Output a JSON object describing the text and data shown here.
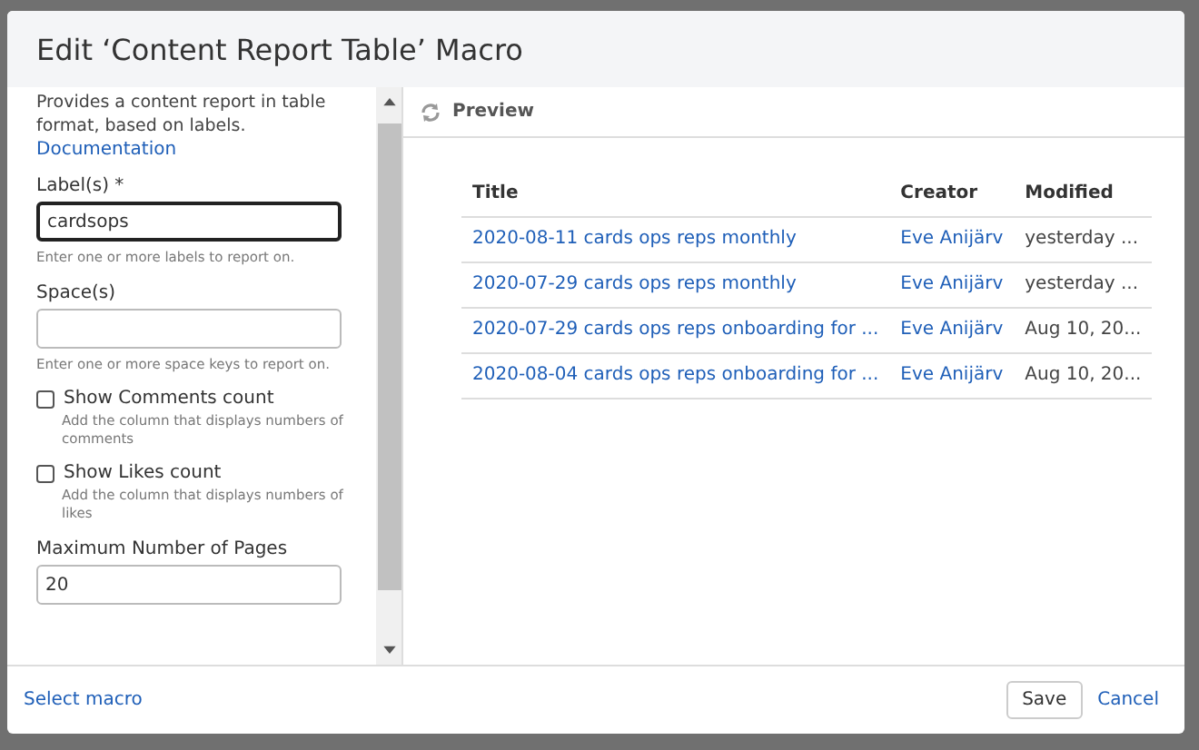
{
  "dialog": {
    "title": "Edit ‘Content Report Table’ Macro"
  },
  "form": {
    "description": "Provides a content report in table format, based on labels.",
    "documentation_link": "Documentation",
    "fields": [
      {
        "kind": "text",
        "label": "Label(s) *",
        "value": "cardsops",
        "focused": true,
        "help": "Enter one or more labels to report on."
      },
      {
        "kind": "text",
        "label": "Space(s)",
        "focused": false,
        "help": "Enter one or more space keys to report on."
      },
      {
        "kind": "checkbox",
        "label": "Show Comments count",
        "checked": false,
        "help": "Add the column that displays numbers of comments"
      },
      {
        "kind": "checkbox",
        "label": "Show Likes count",
        "checked": false,
        "help": "Add the column that displays numbers of likes"
      },
      {
        "kind": "text",
        "label": "Maximum Number of Pages",
        "value": "20",
        "focused": false
      }
    ]
  },
  "preview": {
    "title": "Preview",
    "table": {
      "columns": [
        "Title",
        "Creator",
        "Modified"
      ],
      "rows": [
        [
          "2020-08-11 cards ops reps monthly",
          "Eve Anijärv",
          "yesterday ..."
        ],
        [
          "2020-07-29 cards ops reps monthly",
          "Eve Anijärv",
          "yesterday ..."
        ],
        [
          "2020-07-29 cards ops reps onboarding for ...",
          "Eve Anijärv",
          "Aug 10, 20..."
        ],
        [
          "2020-08-04 cards ops reps onboarding for ...",
          "Eve Anijärv",
          "Aug 10, 20..."
        ]
      ]
    }
  },
  "footer": {
    "link": "Select macro",
    "buttons": [
      {
        "kind": "button",
        "label": "Save"
      },
      {
        "kind": "link",
        "label": "Cancel"
      }
    ]
  }
}
